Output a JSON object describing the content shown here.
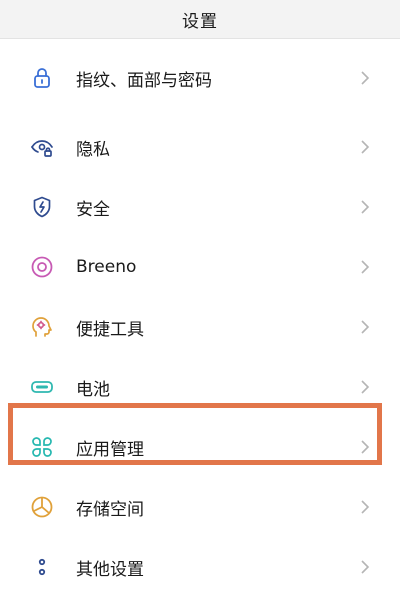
{
  "header": {
    "title": "设置"
  },
  "settings": {
    "items": [
      {
        "label": "指纹、面部与密码",
        "icon": "lock-icon",
        "color": "#3a6fd6"
      },
      {
        "label": "隐私",
        "icon": "eye-lock-icon",
        "color": "#2f4b8f"
      },
      {
        "label": "安全",
        "icon": "shield-icon",
        "color": "#2f4b8f"
      },
      {
        "label": "Breeno",
        "icon": "breeno-icon",
        "color": "#c75ab4"
      },
      {
        "label": "便捷工具",
        "icon": "head-gear-icon",
        "color": "#e0a13a"
      },
      {
        "label": "电池",
        "icon": "battery-icon",
        "color": "#2fb8b0"
      },
      {
        "label": "应用管理",
        "icon": "apps-icon",
        "color": "#26b8b0"
      },
      {
        "label": "存储空间",
        "icon": "pie-chart-icon",
        "color": "#e0a13a"
      },
      {
        "label": "其他设置",
        "icon": "more-icon",
        "color": "#2f4b8f"
      }
    ]
  },
  "highlight_color": "#e2764a"
}
